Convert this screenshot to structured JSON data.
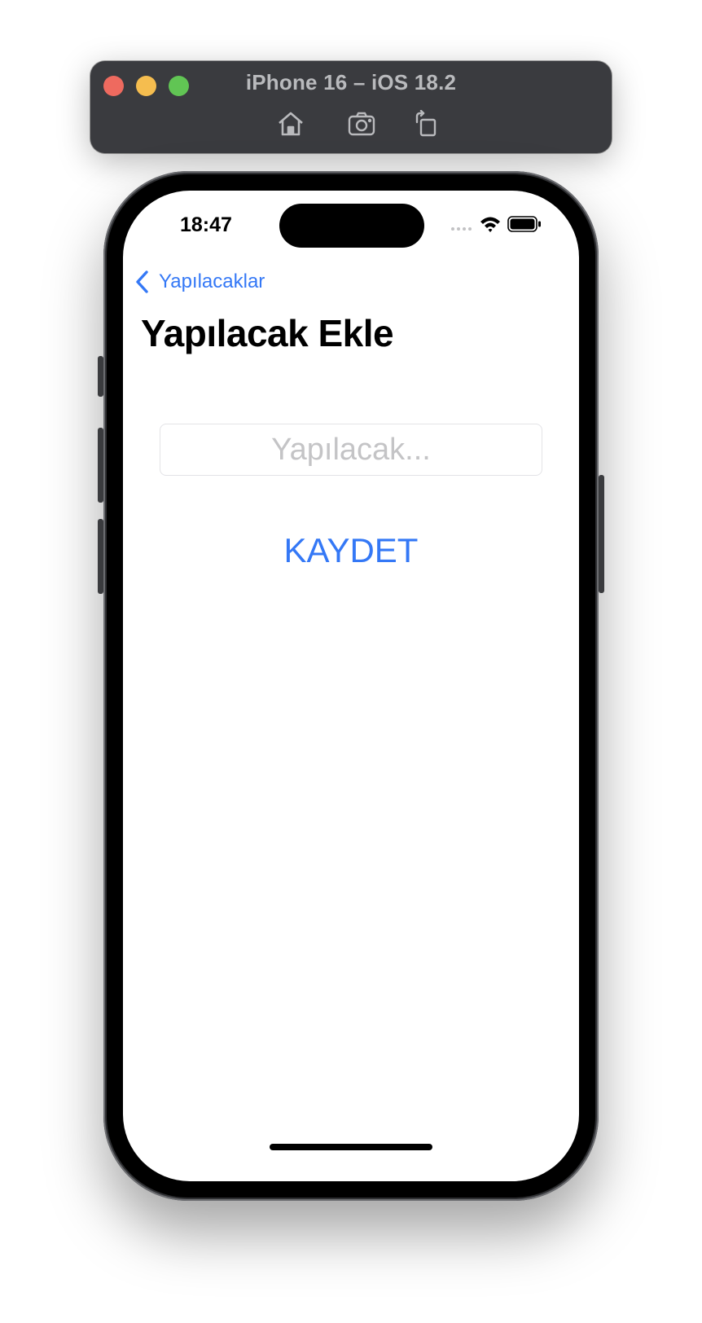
{
  "simulator": {
    "title": "iPhone 16 – iOS 18.2",
    "toolbar": [
      "home-icon",
      "screenshot-icon",
      "rotate-icon"
    ]
  },
  "status_bar": {
    "time": "18:47",
    "icons": [
      "cellular-icon",
      "wifi-icon",
      "battery-icon"
    ]
  },
  "nav": {
    "back_label": "Yapılacaklar",
    "title": "Yapılacak Ekle"
  },
  "form": {
    "todo_value": "",
    "todo_placeholder": "Yapılacak...",
    "save_label": "KAYDET"
  },
  "colors": {
    "accent": "#3478f6",
    "sim_bar": "#3a3b3f",
    "traffic_red": "#ee6a5f",
    "traffic_yellow": "#f5bd4f",
    "traffic_green": "#61c554"
  }
}
